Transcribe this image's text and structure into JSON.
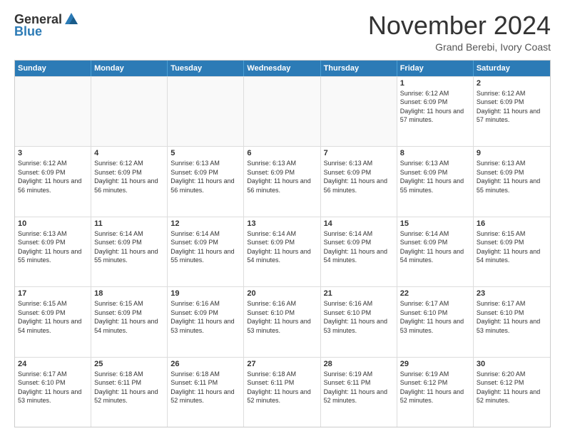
{
  "header": {
    "logo_general": "General",
    "logo_blue": "Blue",
    "month_title": "November 2024",
    "subtitle": "Grand Berebi, Ivory Coast"
  },
  "calendar": {
    "weekdays": [
      "Sunday",
      "Monday",
      "Tuesday",
      "Wednesday",
      "Thursday",
      "Friday",
      "Saturday"
    ],
    "rows": [
      [
        {
          "day": "",
          "empty": true
        },
        {
          "day": "",
          "empty": true
        },
        {
          "day": "",
          "empty": true
        },
        {
          "day": "",
          "empty": true
        },
        {
          "day": "",
          "empty": true
        },
        {
          "day": "1",
          "info": "Sunrise: 6:12 AM\nSunset: 6:09 PM\nDaylight: 11 hours and 57 minutes."
        },
        {
          "day": "2",
          "info": "Sunrise: 6:12 AM\nSunset: 6:09 PM\nDaylight: 11 hours and 57 minutes."
        }
      ],
      [
        {
          "day": "3",
          "info": "Sunrise: 6:12 AM\nSunset: 6:09 PM\nDaylight: 11 hours and 56 minutes."
        },
        {
          "day": "4",
          "info": "Sunrise: 6:12 AM\nSunset: 6:09 PM\nDaylight: 11 hours and 56 minutes."
        },
        {
          "day": "5",
          "info": "Sunrise: 6:13 AM\nSunset: 6:09 PM\nDaylight: 11 hours and 56 minutes."
        },
        {
          "day": "6",
          "info": "Sunrise: 6:13 AM\nSunset: 6:09 PM\nDaylight: 11 hours and 56 minutes."
        },
        {
          "day": "7",
          "info": "Sunrise: 6:13 AM\nSunset: 6:09 PM\nDaylight: 11 hours and 56 minutes."
        },
        {
          "day": "8",
          "info": "Sunrise: 6:13 AM\nSunset: 6:09 PM\nDaylight: 11 hours and 55 minutes."
        },
        {
          "day": "9",
          "info": "Sunrise: 6:13 AM\nSunset: 6:09 PM\nDaylight: 11 hours and 55 minutes."
        }
      ],
      [
        {
          "day": "10",
          "info": "Sunrise: 6:13 AM\nSunset: 6:09 PM\nDaylight: 11 hours and 55 minutes."
        },
        {
          "day": "11",
          "info": "Sunrise: 6:14 AM\nSunset: 6:09 PM\nDaylight: 11 hours and 55 minutes."
        },
        {
          "day": "12",
          "info": "Sunrise: 6:14 AM\nSunset: 6:09 PM\nDaylight: 11 hours and 55 minutes."
        },
        {
          "day": "13",
          "info": "Sunrise: 6:14 AM\nSunset: 6:09 PM\nDaylight: 11 hours and 54 minutes."
        },
        {
          "day": "14",
          "info": "Sunrise: 6:14 AM\nSunset: 6:09 PM\nDaylight: 11 hours and 54 minutes."
        },
        {
          "day": "15",
          "info": "Sunrise: 6:14 AM\nSunset: 6:09 PM\nDaylight: 11 hours and 54 minutes."
        },
        {
          "day": "16",
          "info": "Sunrise: 6:15 AM\nSunset: 6:09 PM\nDaylight: 11 hours and 54 minutes."
        }
      ],
      [
        {
          "day": "17",
          "info": "Sunrise: 6:15 AM\nSunset: 6:09 PM\nDaylight: 11 hours and 54 minutes."
        },
        {
          "day": "18",
          "info": "Sunrise: 6:15 AM\nSunset: 6:09 PM\nDaylight: 11 hours and 54 minutes."
        },
        {
          "day": "19",
          "info": "Sunrise: 6:16 AM\nSunset: 6:09 PM\nDaylight: 11 hours and 53 minutes."
        },
        {
          "day": "20",
          "info": "Sunrise: 6:16 AM\nSunset: 6:10 PM\nDaylight: 11 hours and 53 minutes."
        },
        {
          "day": "21",
          "info": "Sunrise: 6:16 AM\nSunset: 6:10 PM\nDaylight: 11 hours and 53 minutes."
        },
        {
          "day": "22",
          "info": "Sunrise: 6:17 AM\nSunset: 6:10 PM\nDaylight: 11 hours and 53 minutes."
        },
        {
          "day": "23",
          "info": "Sunrise: 6:17 AM\nSunset: 6:10 PM\nDaylight: 11 hours and 53 minutes."
        }
      ],
      [
        {
          "day": "24",
          "info": "Sunrise: 6:17 AM\nSunset: 6:10 PM\nDaylight: 11 hours and 53 minutes."
        },
        {
          "day": "25",
          "info": "Sunrise: 6:18 AM\nSunset: 6:11 PM\nDaylight: 11 hours and 52 minutes."
        },
        {
          "day": "26",
          "info": "Sunrise: 6:18 AM\nSunset: 6:11 PM\nDaylight: 11 hours and 52 minutes."
        },
        {
          "day": "27",
          "info": "Sunrise: 6:18 AM\nSunset: 6:11 PM\nDaylight: 11 hours and 52 minutes."
        },
        {
          "day": "28",
          "info": "Sunrise: 6:19 AM\nSunset: 6:11 PM\nDaylight: 11 hours and 52 minutes."
        },
        {
          "day": "29",
          "info": "Sunrise: 6:19 AM\nSunset: 6:12 PM\nDaylight: 11 hours and 52 minutes."
        },
        {
          "day": "30",
          "info": "Sunrise: 6:20 AM\nSunset: 6:12 PM\nDaylight: 11 hours and 52 minutes."
        }
      ]
    ]
  }
}
